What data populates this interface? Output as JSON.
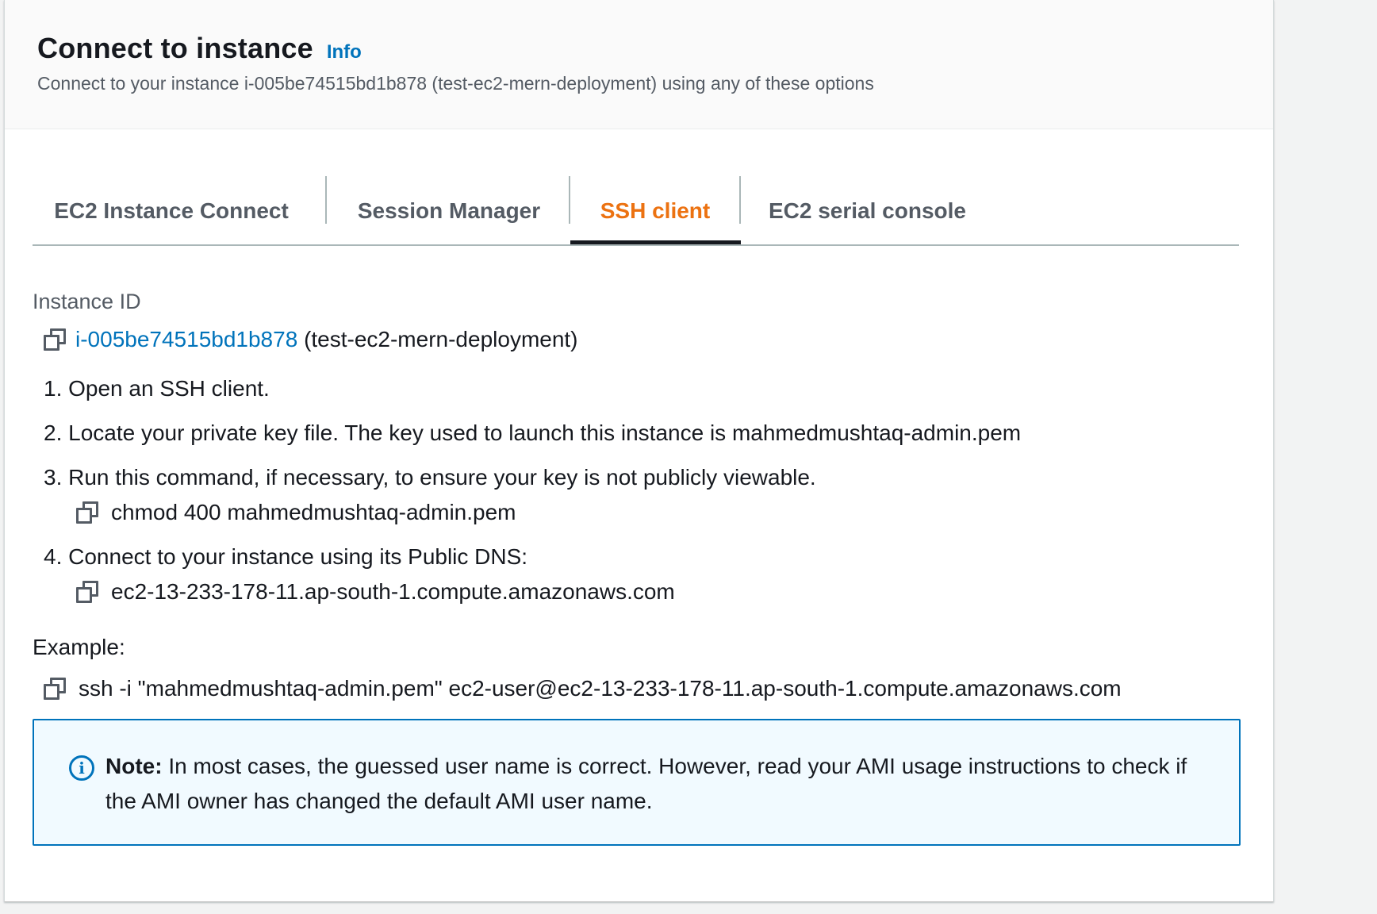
{
  "header": {
    "title": "Connect to instance",
    "info_link": "Info",
    "subtitle": "Connect to your instance i-005be74515bd1b878 (test-ec2-mern-deployment) using any of these options"
  },
  "tabs": [
    {
      "label": "EC2 Instance Connect",
      "active": false
    },
    {
      "label": "Session Manager",
      "active": false
    },
    {
      "label": "SSH client",
      "active": true
    },
    {
      "label": "EC2 serial console",
      "active": false
    }
  ],
  "instance": {
    "label": "Instance ID",
    "id": "i-005be74515bd1b878",
    "name": "(test-ec2-mern-deployment)"
  },
  "steps": [
    {
      "text": "1. Open an SSH client."
    },
    {
      "text": "2. Locate your private key file. The key used to launch this instance is mahmedmushtaq-admin.pem"
    },
    {
      "text": "3. Run this command, if necessary, to ensure your key is not publicly viewable.",
      "command": "chmod 400 mahmedmushtaq-admin.pem"
    },
    {
      "text": "4. Connect to your instance using its Public DNS:",
      "command": "ec2-13-233-178-11.ap-south-1.compute.amazonaws.com"
    }
  ],
  "example": {
    "label": "Example:",
    "command": "ssh -i \"mahmedmushtaq-admin.pem\" ec2-user@ec2-13-233-178-11.ap-south-1.compute.amazonaws.com"
  },
  "note": {
    "prefix": "Note:",
    "text": "In most cases, the guessed user name is correct. However, read your AMI usage instructions to check if the AMI owner has changed the default AMI user name."
  },
  "colors": {
    "accent_tab": "#ec7211",
    "link": "#0073bb",
    "note_bg": "#f1faff"
  }
}
